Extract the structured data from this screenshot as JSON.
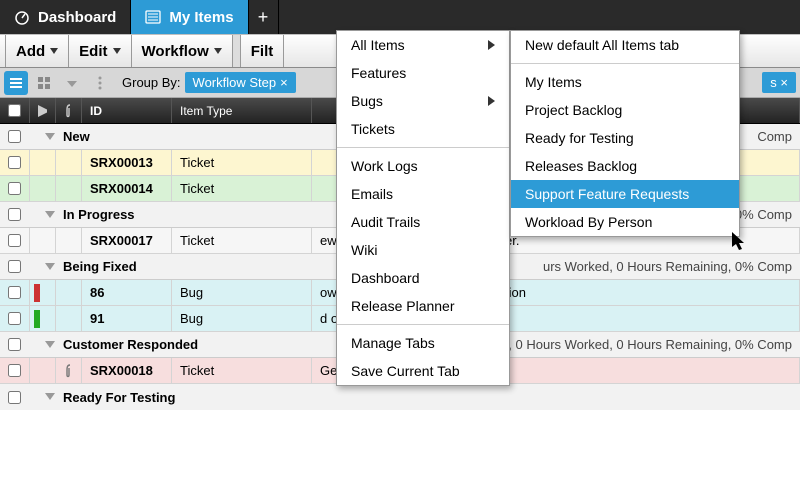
{
  "tabs": {
    "dashboard": "Dashboard",
    "myitems": "My Items"
  },
  "toolbar": {
    "add": "Add",
    "edit": "Edit",
    "workflow": "Workflow",
    "filter": "Filt"
  },
  "viewbar": {
    "groupby_label": "Group By:",
    "groupby_value": "Workflow Step"
  },
  "right_chip_suffix": "s ×",
  "thead": {
    "id": "ID",
    "type": "Item Type"
  },
  "groups": {
    "new": {
      "name": "New",
      "stats_tail": "Comp"
    },
    "inprogress": {
      "name": "In Progress",
      "stats": "urs Worked, 0 Hours Remaining, 0% Comp"
    },
    "beingfixed": {
      "name": "Being Fixed",
      "stats": "urs Worked, 0 Hours Remaining, 0% Comp"
    },
    "custresp": {
      "name": "Customer Responded",
      "stats": "1 Items, 0 Hours Worked, 0 Hours Remaining, 0% Comp"
    },
    "ready": {
      "name": "Ready For Testing",
      "stats_tail": ""
    }
  },
  "rows": {
    "r1": {
      "id": "SRX00013",
      "type": "Ticket"
    },
    "r2": {
      "id": "SRX00014",
      "type": "Ticket"
    },
    "r3": {
      "id": "SRX00017",
      "type": "Ticket",
      "summary": "ew the site using Internet Explorer."
    },
    "r4": {
      "id": "86",
      "type": "Bug",
      "summary": "ow assignments after initial creation"
    },
    "r5": {
      "id": "91",
      "type": "Bug",
      "summary": "d on exit"
    },
    "r6": {
      "id": "SRX00018",
      "type": "Ticket",
      "summary": "Getting error on login!!"
    }
  },
  "menu1": {
    "all_items": "All Items",
    "features": "Features",
    "bugs": "Bugs",
    "tickets": "Tickets",
    "worklogs": "Work Logs",
    "emails": "Emails",
    "audit": "Audit Trails",
    "wiki": "Wiki",
    "dashboard": "Dashboard",
    "release": "Release Planner",
    "manage": "Manage Tabs",
    "save": "Save Current Tab"
  },
  "menu2": {
    "newdefault": "New default All Items tab",
    "myitems": "My Items",
    "backlog": "Project Backlog",
    "ready": "Ready for Testing",
    "releases": "Releases Backlog",
    "support": "Support Feature Requests",
    "workload": "Workload By Person"
  }
}
